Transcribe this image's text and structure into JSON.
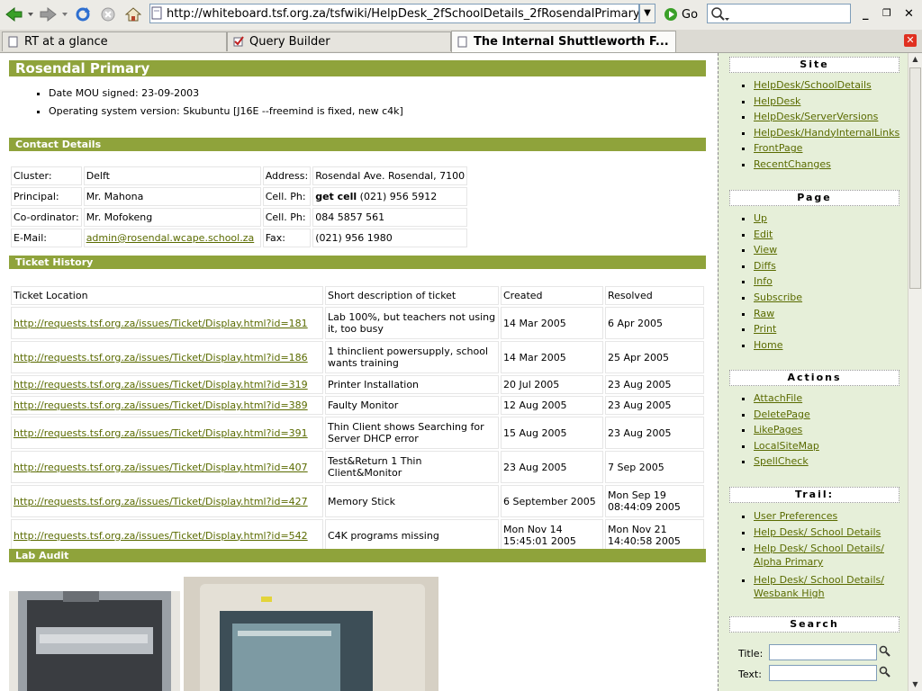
{
  "browser": {
    "url": "http://whiteboard.tsf.org.za/tsfwiki/HelpDesk_2fSchoolDetails_2fRosendalPrimary",
    "go_label": "Go",
    "tabs": [
      {
        "label": "RT at a glance"
      },
      {
        "label": "Query Builder"
      },
      {
        "label": "The Internal Shuttleworth F..."
      }
    ]
  },
  "page": {
    "title": "Rosendal Primary",
    "bullets": [
      "Date MOU signed: 23-09-2003",
      "Operating system version: Skubuntu [J16E --freemind is fixed, new c4k]"
    ],
    "contact_heading": "Contact Details",
    "contact": {
      "cluster_label": "Cluster:",
      "cluster": "Delft",
      "address_label": "Address:",
      "address": "Rosendal Ave. Rosendal, 7100",
      "principal_label": "Principal:",
      "principal": "Mr. Mahona",
      "cell1_label": "Cell. Ph:",
      "cell1_bold": "get cell",
      "cell1": " (021) 956 5912",
      "coord_label": "Co-ordinator:",
      "coord": "Mr. Mofokeng",
      "cell2_label": "Cell. Ph:",
      "cell2": "084 5857 561",
      "email_label": "E-Mail:",
      "email": "admin@rosendal.wcape.school.za",
      "fax_label": "Fax:",
      "fax": "(021) 956 1980"
    },
    "ticket_heading": "Ticket History",
    "ticket_headers": [
      "Ticket Location",
      "Short description of ticket",
      "Created",
      "Resolved"
    ],
    "tickets": [
      {
        "url": "http://requests.tsf.org.za/issues/Ticket/Display.html?id=181",
        "desc": "Lab 100%, but teachers not using it, too busy",
        "created": "14 Mar 2005",
        "resolved": "6 Apr 2005"
      },
      {
        "url": "http://requests.tsf.org.za/issues/Ticket/Display.html?id=186",
        "desc": "1 thinclient powersupply, school wants training",
        "created": "14 Mar 2005",
        "resolved": "25 Apr 2005"
      },
      {
        "url": "http://requests.tsf.org.za/issues/Ticket/Display.html?id=319",
        "desc": "Printer Installation",
        "created": "20 Jul 2005",
        "resolved": "23 Aug 2005"
      },
      {
        "url": "http://requests.tsf.org.za/issues/Ticket/Display.html?id=389",
        "desc": "Faulty Monitor",
        "created": "12 Aug 2005",
        "resolved": "23 Aug 2005"
      },
      {
        "url": "http://requests.tsf.org.za/issues/Ticket/Display.html?id=391",
        "desc": "Thin Client shows Searching for Server DHCP error",
        "created": "15 Aug 2005",
        "resolved": "23 Aug 2005"
      },
      {
        "url": "http://requests.tsf.org.za/issues/Ticket/Display.html?id=407",
        "desc": "Test&Return 1 Thin Client&Monitor",
        "created": "23 Aug 2005",
        "resolved": "7 Sep 2005"
      },
      {
        "url": "http://requests.tsf.org.za/issues/Ticket/Display.html?id=427",
        "desc": "Memory Stick",
        "created": "6 September 2005",
        "resolved": "Mon Sep 19 08:44:09 2005"
      },
      {
        "url": "http://requests.tsf.org.za/issues/Ticket/Display.html?id=542",
        "desc": "C4K programs missing",
        "created": "Mon Nov 14 15:45:01 2005",
        "resolved": "Mon Nov 21 14:40:58 2005"
      }
    ],
    "lab_heading": "Lab Audit"
  },
  "sidebar": {
    "site_heading": "Site",
    "site_links": [
      "HelpDesk/SchoolDetails",
      "HelpDesk",
      "HelpDesk/ServerVersions",
      "HelpDesk/HandyInternalLinks",
      "FrontPage",
      "RecentChanges"
    ],
    "page_heading": "Page",
    "page_links": [
      "Up",
      "Edit",
      "View",
      "Diffs",
      "Info",
      "Subscribe",
      "Raw",
      "Print",
      "Home"
    ],
    "actions_heading": "Actions",
    "action_links": [
      "AttachFile",
      "DeletePage",
      "LikePages",
      "LocalSiteMap",
      "SpellCheck"
    ],
    "trail_heading": "Trail:",
    "trail_links": [
      "User Preferences",
      "Help Desk/ School Details",
      "Help Desk/ School Details/ Alpha Primary",
      "Help Desk/ School Details/ Wesbank High"
    ],
    "search_heading": "Search",
    "title_label": "Title:",
    "text_label": "Text:"
  }
}
